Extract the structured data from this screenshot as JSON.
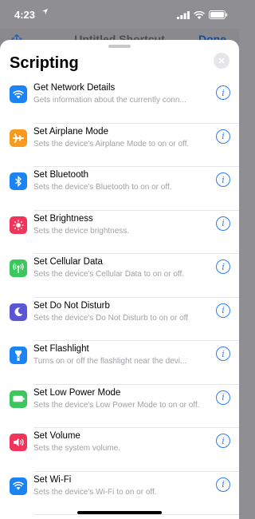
{
  "status": {
    "time": "4:23"
  },
  "underlay": {
    "title": "Untitled Shortcut",
    "done_label": "Done"
  },
  "sheet": {
    "title": "Scripting"
  },
  "actions": [
    {
      "title": "Get Network Details",
      "subtitle": "Gets information about the currently conn...",
      "icon": "wifi-icon",
      "color": "#1a84f4"
    },
    {
      "title": "Set Airplane Mode",
      "subtitle": "Sets the device's Airplane Mode to on or off.",
      "icon": "airplane-icon",
      "color": "#f99a1c"
    },
    {
      "title": "Set Bluetooth",
      "subtitle": "Sets the device's Bluetooth to on or off.",
      "icon": "bluetooth-icon",
      "color": "#1a84f4"
    },
    {
      "title": "Set Brightness",
      "subtitle": "Sets the device brightness.",
      "icon": "brightness-icon",
      "color": "#f2345a"
    },
    {
      "title": "Set Cellular Data",
      "subtitle": "Sets the device's Cellular Data to on or off.",
      "icon": "cellular-icon",
      "color": "#3ac75b"
    },
    {
      "title": "Set Do Not Disturb",
      "subtitle": "Sets the device's Do Not Disturb to on or off",
      "icon": "moon-icon",
      "color": "#5a56d6"
    },
    {
      "title": "Set Flashlight",
      "subtitle": "Turns on or off the flashlight near the devi...",
      "icon": "flashlight-icon",
      "color": "#1a84f4"
    },
    {
      "title": "Set Low Power Mode",
      "subtitle": "Sets the device's Low Power Mode to on or off.",
      "icon": "battery-icon",
      "color": "#3ac75b"
    },
    {
      "title": "Set Volume",
      "subtitle": "Sets the system volume.",
      "icon": "speaker-icon",
      "color": "#f2345a"
    },
    {
      "title": "Set Wi-Fi",
      "subtitle": "Sets the device's Wi-Fi to on or off.",
      "icon": "wifi-icon",
      "color": "#1a84f4"
    }
  ],
  "info_glyph": "i"
}
